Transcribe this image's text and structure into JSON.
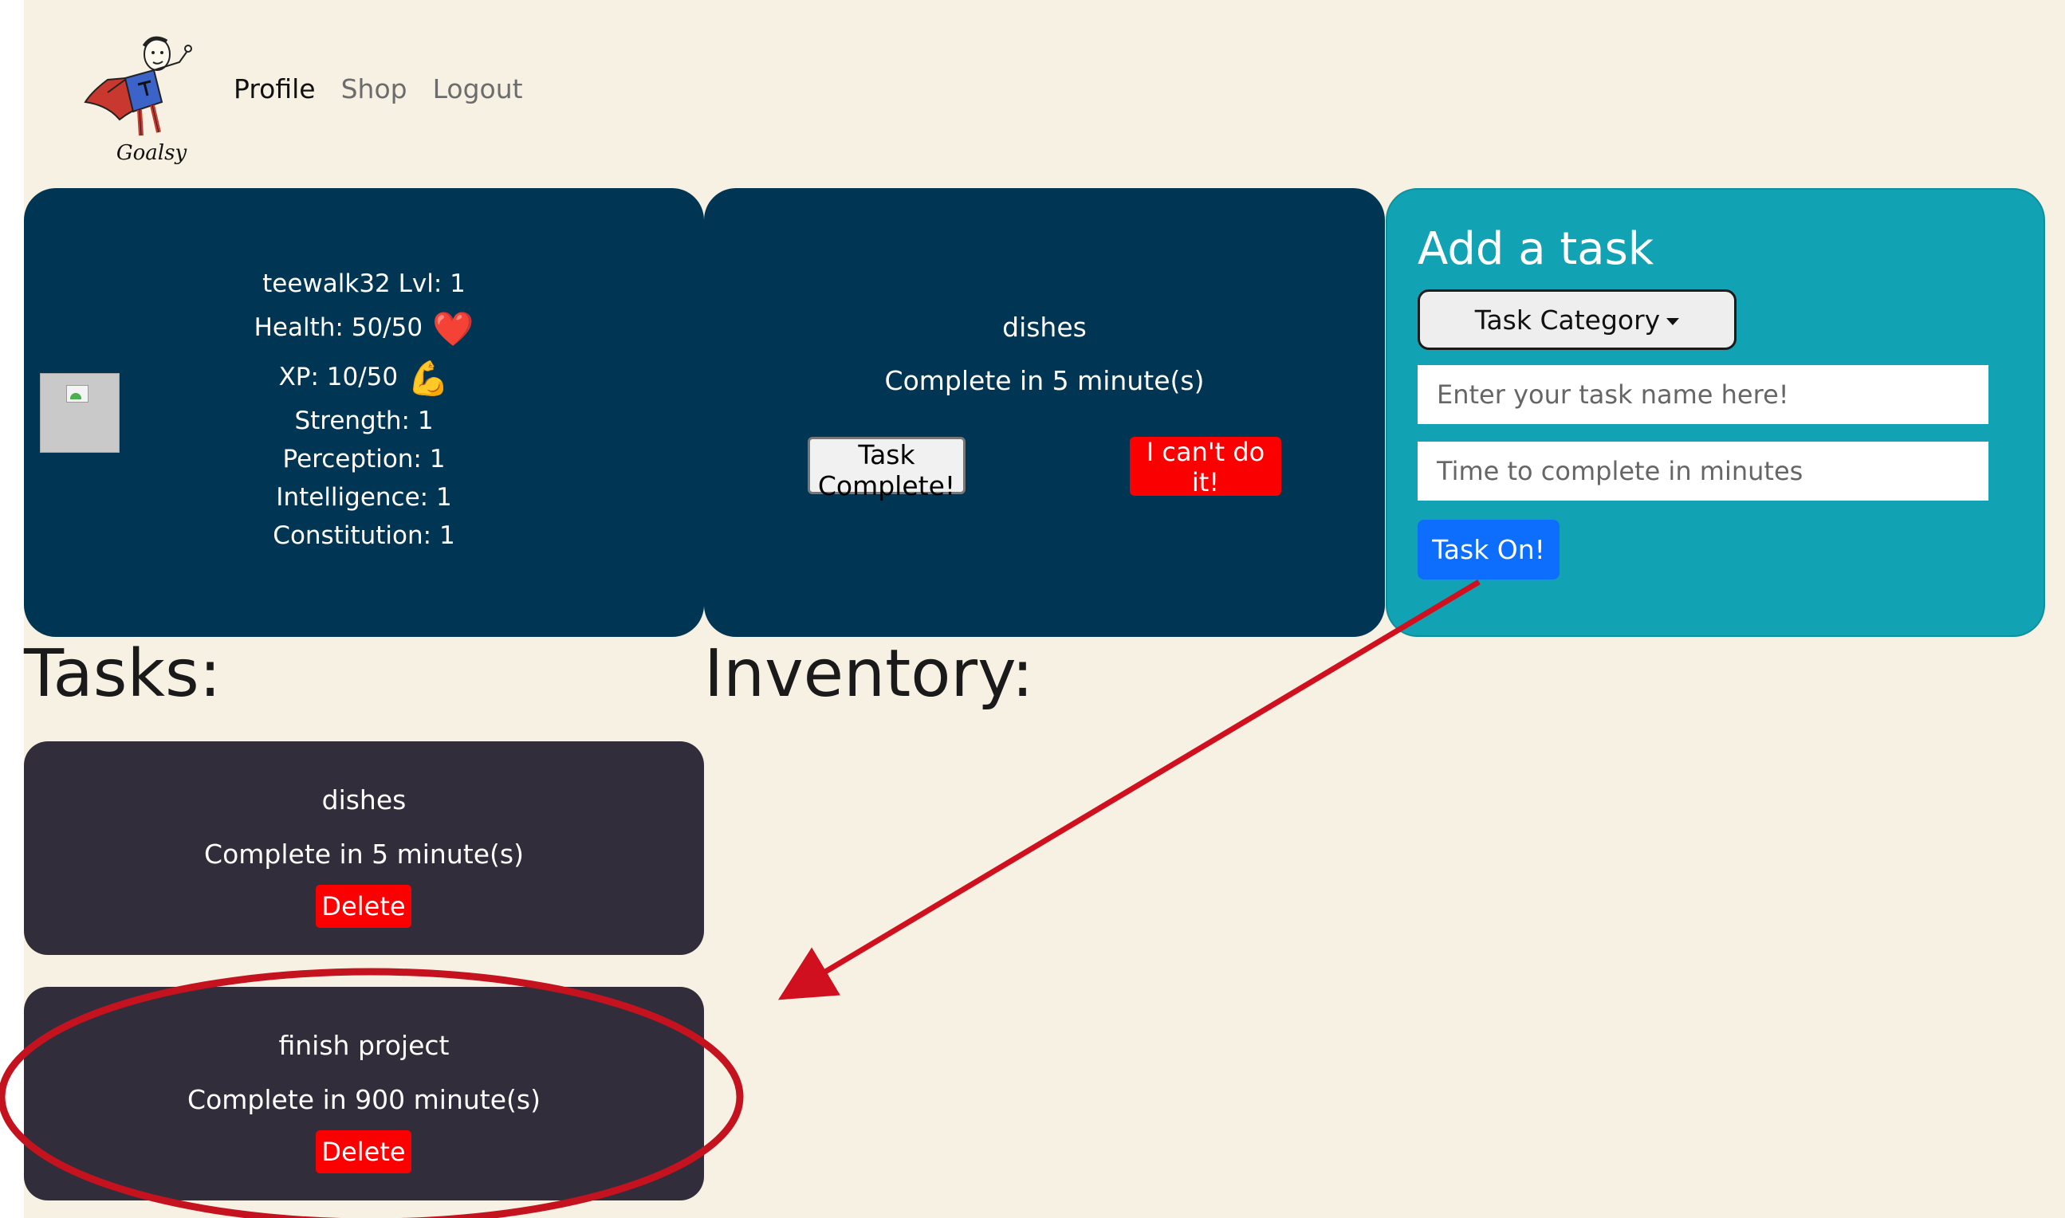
{
  "brand": {
    "name": "Goalsy"
  },
  "nav": {
    "items": [
      "Profile",
      "Shop",
      "Logout"
    ],
    "active": "Profile"
  },
  "profile": {
    "title_line": "teewalk32 Lvl: 1",
    "health": "Health: 50/50",
    "health_icon": "heart-icon",
    "xp": "XP: 10/50",
    "xp_icon": "flexed-arm-icon",
    "strength": "Strength: 1",
    "perception": "Perception: 1",
    "intelligence": "Intelligence: 1",
    "constitution": "Constitution: 1"
  },
  "current_task": {
    "name": "dishes",
    "duration": "Complete in 5 minute(s)",
    "complete_label": "Task Complete!",
    "cant_label": "I can't do it!"
  },
  "add_task": {
    "title": "Add a task",
    "category_label": "Task Category",
    "name_placeholder": "Enter your task name here!",
    "time_placeholder": "Time to complete in minutes",
    "submit_label": "Task On!"
  },
  "headings": {
    "tasks": "Tasks:",
    "inventory": "Inventory:"
  },
  "tasks": [
    {
      "name": "dishes",
      "duration": "Complete in 5 minute(s)",
      "delete_label": "Delete"
    },
    {
      "name": "finish project",
      "duration": "Complete in 900 minute(s)",
      "delete_label": "Delete"
    }
  ],
  "colors": {
    "page_bg": "#f6f1e2",
    "card_navy": "#013554",
    "card_teal": "#11a3b3",
    "task_card": "#322d3a",
    "danger": "#fa0000",
    "primary": "#0d6efd",
    "annotation": "#d0101e"
  }
}
